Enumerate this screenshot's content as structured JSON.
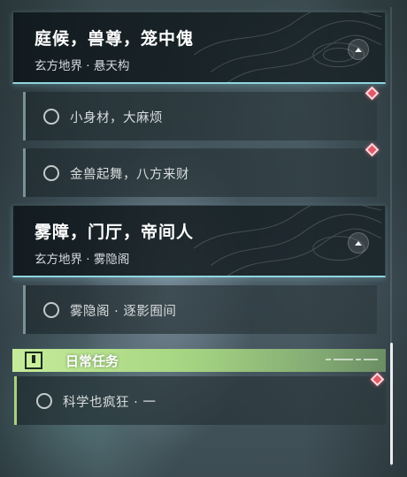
{
  "quests": [
    {
      "title": "庭候，兽尊，笼中傀",
      "subtitle": "玄方地界 · 悬天构",
      "tasks": [
        "小身材，大麻烦",
        "金兽起舞，八方来财"
      ]
    },
    {
      "title": "雾障，门厅，帝间人",
      "subtitle": "玄方地界 · 雾隐阁",
      "tasks": [
        "雾隐阁 · 逐影囿间"
      ]
    }
  ],
  "daily": {
    "title": "日常任务",
    "icon": "exclamation-icon",
    "tasks": [
      "科学也疯狂 · 一"
    ]
  },
  "icons": {
    "collapse": "chevron-up-icon",
    "marker": "red-diamond-marker-icon",
    "task_status": "empty-circle-icon"
  },
  "colors": {
    "accent_cyan": "#8fd6e0",
    "daily_green": "#c5eb9a",
    "marker_red": "#e05a6a"
  }
}
